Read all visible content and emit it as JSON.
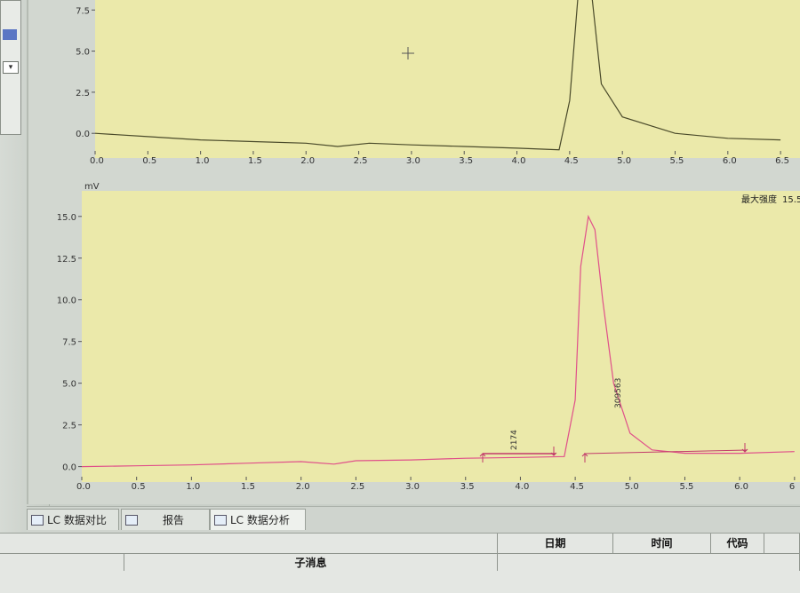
{
  "top_chart": {
    "x_ticks": [
      "0.0",
      "0.5",
      "1.0",
      "1.5",
      "2.0",
      "2.5",
      "3.0",
      "3.5",
      "4.0",
      "4.5",
      "5.0",
      "5.5",
      "6.0",
      "6.5"
    ],
    "y_ticks": [
      "0.0",
      "2.5",
      "5.0",
      "7.5"
    ]
  },
  "bottom_chart": {
    "y_unit": "mV",
    "max_intensity_label": "最大强度",
    "max_intensity_value": "15.5",
    "x_ticks": [
      "0.0",
      "0.5",
      "1.0",
      "1.5",
      "2.0",
      "2.5",
      "3.0",
      "3.5",
      "4.0",
      "4.5",
      "5.0",
      "5.5",
      "6.0",
      "6"
    ],
    "y_ticks": [
      "0.0",
      "2.5",
      "5.0",
      "7.5",
      "10.0",
      "12.5",
      "15.0"
    ],
    "peak_labels": [
      "2174",
      "309563"
    ]
  },
  "chart_data": [
    {
      "type": "line",
      "x": [
        0.0,
        0.5,
        1.0,
        1.5,
        2.0,
        2.3,
        2.6,
        3.0,
        3.5,
        4.0,
        4.4,
        4.5,
        4.6,
        4.7,
        4.8,
        5.0,
        5.5,
        6.0,
        6.5
      ],
      "y": [
        0.0,
        -0.2,
        -0.4,
        -0.5,
        -0.6,
        -0.8,
        -0.6,
        -0.7,
        -0.8,
        -0.9,
        -1.0,
        2.0,
        10.0,
        9.0,
        3.0,
        1.0,
        0.0,
        -0.3,
        -0.4
      ],
      "ylim": [
        -1.5,
        8.0
      ],
      "xlim": [
        0.0,
        6.6
      ],
      "color": "#4a4a2a"
    },
    {
      "type": "line",
      "x": [
        0.0,
        0.5,
        1.0,
        1.5,
        2.0,
        2.3,
        2.5,
        3.0,
        3.5,
        4.0,
        4.4,
        4.5,
        4.55,
        4.62,
        4.68,
        4.75,
        4.85,
        5.0,
        5.2,
        5.5,
        6.0,
        6.5
      ],
      "y": [
        0.0,
        0.05,
        0.1,
        0.2,
        0.3,
        0.15,
        0.35,
        0.4,
        0.5,
        0.55,
        0.6,
        4.0,
        12.0,
        15.0,
        14.2,
        10.0,
        5.0,
        2.0,
        1.0,
        0.8,
        0.8,
        0.9
      ],
      "ylim": [
        -0.5,
        16.0
      ],
      "xlim": [
        0.0,
        6.55
      ],
      "color": "#e0508a"
    }
  ],
  "tabs": [
    {
      "label": "LC 数据对比"
    },
    {
      "label": "报告"
    },
    {
      "label": "LC 数据分析"
    }
  ],
  "message_table": {
    "headers": [
      "子消息",
      "日期",
      "时间",
      "代码"
    ]
  }
}
